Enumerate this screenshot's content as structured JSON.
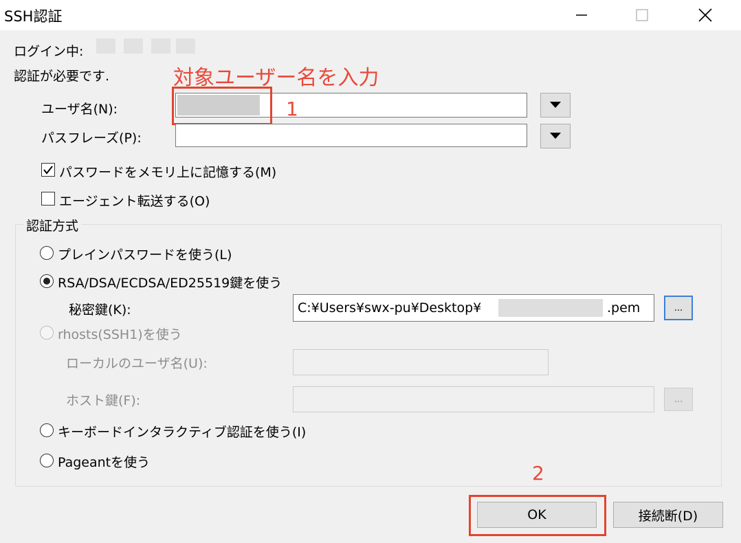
{
  "window": {
    "title": "SSH認証",
    "controls": {
      "minimize": "minimize-icon",
      "maximize": "maximize-icon",
      "close": "close-icon"
    }
  },
  "login_label": "ログイン中:",
  "auth_required": "認証が必要です.",
  "username": {
    "label": "ユーザ名(N):",
    "value": ""
  },
  "passphrase": {
    "label": "パスフレーズ(P):",
    "value": ""
  },
  "remember_password": {
    "label": "パスワードをメモリ上に記憶する(M)",
    "checked": true
  },
  "agent_forward": {
    "label": "エージェント転送する(O)",
    "checked": false
  },
  "auth_method": {
    "group_label": "認証方式",
    "plain_password": "プレインパスワードを使う(L)",
    "rsa_key": "RSA/DSA/ECDSA/ED25519鍵を使う",
    "private_key_label": "秘密鍵(K):",
    "private_key_prefix": "C:¥Users¥swx-pu¥Desktop¥",
    "private_key_suffix": ".pem",
    "browse_label": "...",
    "rhosts": "rhosts(SSH1)を使う",
    "local_user_label": "ローカルのユーザ名(U):",
    "host_key_label": "ホスト鍵(F):",
    "host_browse_label": "...",
    "keyboard_interactive": "キーボードインタラクティブ認証を使う(I)",
    "pageant": "Pageantを使う",
    "selected": "rsa_key"
  },
  "buttons": {
    "ok": "OK",
    "disconnect": "接続断(D)"
  },
  "annotations": {
    "instruction": "対象ユーザー名を入力",
    "step1": "1",
    "step2": "2",
    "color": "#e8493a"
  }
}
